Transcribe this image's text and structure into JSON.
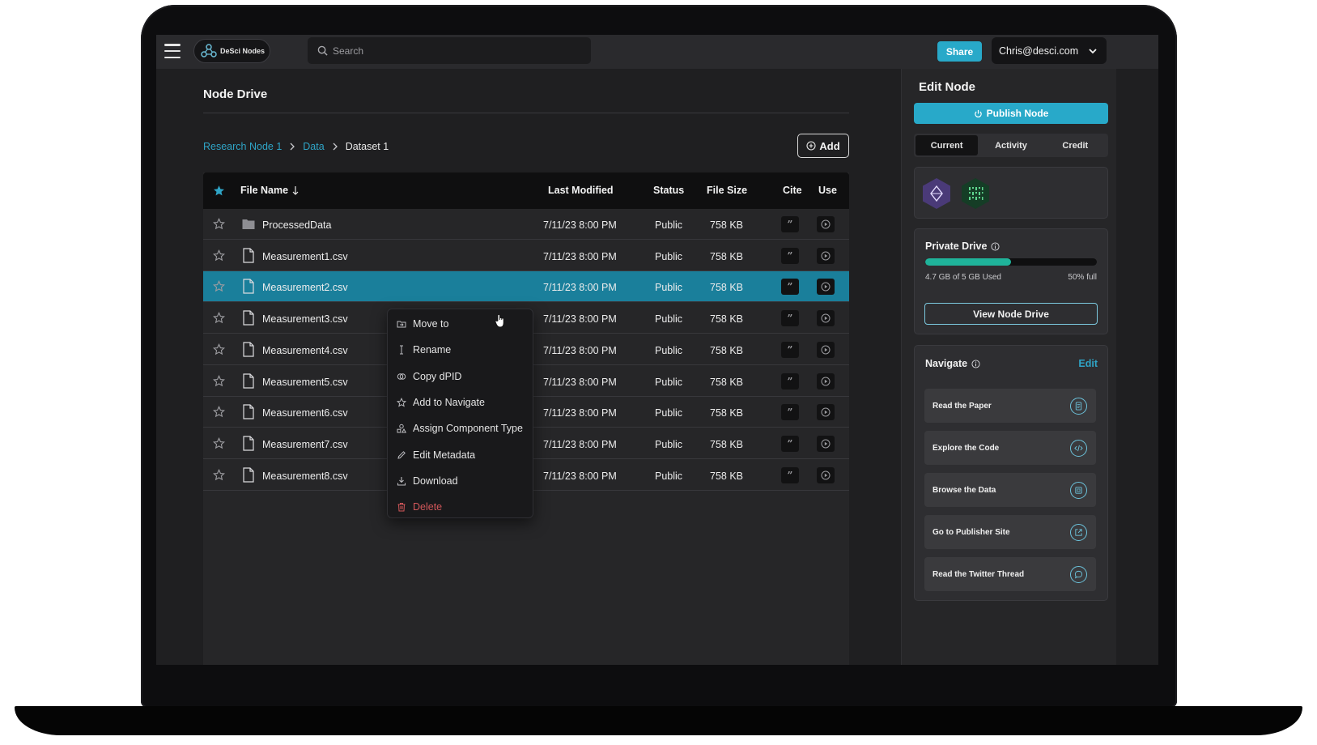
{
  "app": {
    "logo_text": "DeSci Nodes"
  },
  "search": {
    "placeholder": "Search"
  },
  "header": {
    "share_label": "Share",
    "user_email": "Chris@desci.com"
  },
  "main": {
    "title": "Node Drive",
    "breadcrumb": [
      {
        "label": "Research Node 1"
      },
      {
        "label": "Data"
      },
      {
        "label": "Dataset 1"
      }
    ],
    "add_label": "Add",
    "table": {
      "columns": [
        "File Name",
        "Last Modified",
        "Status",
        "File Size",
        "Cite",
        "Use"
      ],
      "rows": [
        {
          "name": "ProcessedData",
          "type": "folder",
          "modified": "7/11/23 8:00 PM",
          "status": "Public",
          "size": "758 KB"
        },
        {
          "name": "Measurement1.csv",
          "type": "file",
          "modified": "7/11/23 8:00 PM",
          "status": "Public",
          "size": "758 KB"
        },
        {
          "name": "Measurement2.csv",
          "type": "file",
          "modified": "7/11/23 8:00 PM",
          "status": "Public",
          "size": "758 KB",
          "selected": true
        },
        {
          "name": "Measurement3.csv",
          "type": "file",
          "modified": "7/11/23 8:00 PM",
          "status": "Public",
          "size": "758 KB"
        },
        {
          "name": "Measurement4.csv",
          "type": "file",
          "modified": "7/11/23 8:00 PM",
          "status": "Public",
          "size": "758 KB"
        },
        {
          "name": "Measurement5.csv",
          "type": "file",
          "modified": "7/11/23 8:00 PM",
          "status": "Public",
          "size": "758 KB"
        },
        {
          "name": "Measurement6.csv",
          "type": "file",
          "modified": "7/11/23 8:00 PM",
          "status": "Public",
          "size": "758 KB"
        },
        {
          "name": "Measurement7.csv",
          "type": "file",
          "modified": "7/11/23 8:00 PM",
          "status": "Public",
          "size": "758 KB"
        },
        {
          "name": "Measurement8.csv",
          "type": "file",
          "modified": "7/11/23 8:00 PM",
          "status": "Public",
          "size": "758 KB"
        }
      ]
    },
    "context_menu": [
      {
        "label": "Move to",
        "icon": "folder-move-icon"
      },
      {
        "label": "Rename",
        "icon": "text-cursor-icon"
      },
      {
        "label": "Copy dPID",
        "icon": "copy-icon"
      },
      {
        "label": "Add to Navigate",
        "icon": "star-icon"
      },
      {
        "label": "Assign Component Type",
        "icon": "shapes-icon"
      },
      {
        "label": "Edit Metadata",
        "icon": "pencil-icon"
      },
      {
        "label": "Download",
        "icon": "download-icon"
      },
      {
        "label": "Delete",
        "icon": "trash-icon"
      }
    ]
  },
  "sidebar": {
    "title": "Edit Node",
    "publish_label": "Publish Node",
    "tabs": [
      "Current",
      "Activity",
      "Credit"
    ],
    "active_tab": "Current",
    "private_drive": {
      "title": "Private Drive",
      "used_text": "4.7 GB of 5 GB Used",
      "percent_text": "50% full",
      "fill_fraction": 0.5,
      "view_label": "View Node Drive"
    },
    "navigate": {
      "title": "Navigate",
      "edit_label": "Edit",
      "items": [
        {
          "label": "Read the Paper",
          "icon": "document-icon"
        },
        {
          "label": "Explore the Code",
          "icon": "code-icon"
        },
        {
          "label": "Browse the Data",
          "icon": "data-icon"
        },
        {
          "label": "Go to Publisher Site",
          "icon": "external-link-icon"
        },
        {
          "label": "Read the Twitter Thread",
          "icon": "chat-bubble-icon"
        }
      ]
    }
  },
  "colors": {
    "accent": "#28a9c9",
    "selected_row": "#1a7f9b",
    "progress": "#1fb39a",
    "danger": "#d2575a"
  }
}
